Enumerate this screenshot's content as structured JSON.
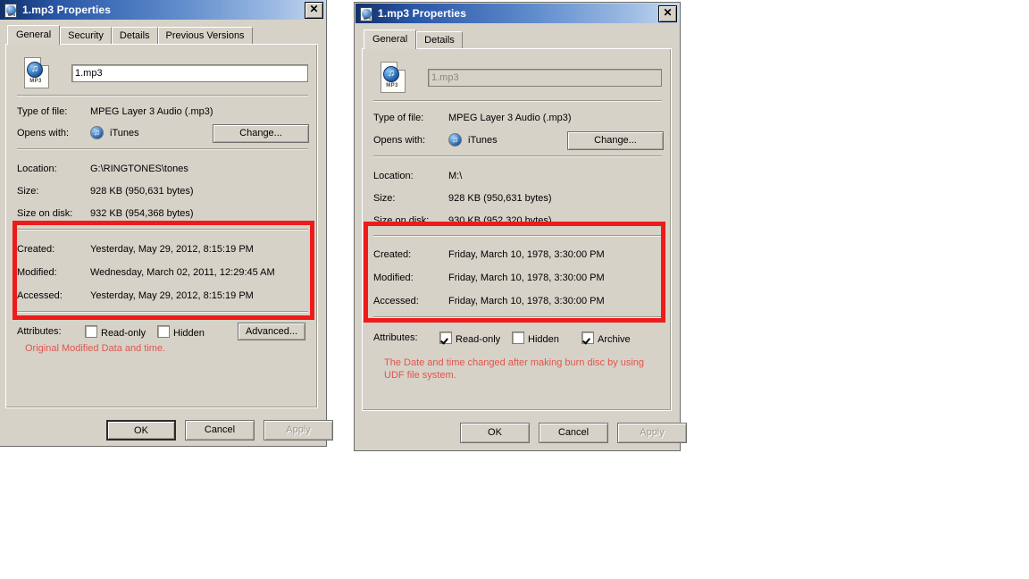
{
  "colors": {
    "dialog_face": "#d6d2c8",
    "titlebar_start": "#10316b",
    "titlebar_end": "#c6d9ef",
    "annotation_red": "#ee1b1b",
    "note_red": "#e0564e"
  },
  "windows": [
    {
      "id": "window-1",
      "title": "1.mp3 Properties",
      "title_icon": "mp3-file-icon",
      "close_label": "✕",
      "tabs": [
        {
          "label": "General",
          "active": true
        },
        {
          "label": "Security",
          "active": false
        },
        {
          "label": "Details",
          "active": false
        },
        {
          "label": "Previous Versions",
          "active": false
        }
      ],
      "file_icon": "mp3-file-icon",
      "filename": {
        "value": "1.mp3",
        "placeholder": "File name",
        "readonly": false
      },
      "fields": [
        {
          "key": "Type of file:",
          "value": "MPEG Layer 3 Audio (.mp3)"
        },
        {
          "key": "Opens with:",
          "value": "iTunes",
          "icon": "itunes-icon"
        },
        {
          "key": "Location:",
          "value": "G:\\RINGTONES\\tones"
        },
        {
          "key": "Size:",
          "value": "928 KB (950,631 bytes)"
        },
        {
          "key": "Size on disk:",
          "value": "932 KB (954,368 bytes)"
        },
        {
          "key": "Created:",
          "value": "Yesterday, May 29, 2012, 8:15:19 PM"
        },
        {
          "key": "Modified:",
          "value": "Wednesday, March 02, 2011, 12:29:45 AM"
        },
        {
          "key": "Accessed:",
          "value": "Yesterday, May 29, 2012, 8:15:19 PM"
        }
      ],
      "change_button": "Change...",
      "attributes_label": "Attributes:",
      "attributes": [
        {
          "label": "Read-only",
          "checked": false
        },
        {
          "label": "Hidden",
          "checked": false
        }
      ],
      "advanced_button": "Advanced...",
      "note": "Original Modified Data and time.",
      "footer": [
        {
          "label": "OK",
          "default": true,
          "disabled": false
        },
        {
          "label": "Cancel",
          "default": false,
          "disabled": false
        },
        {
          "label": "Apply",
          "default": false,
          "disabled": true
        }
      ]
    },
    {
      "id": "window-2",
      "title": "1.mp3 Properties",
      "title_icon": "mp3-file-icon",
      "close_label": "✕",
      "tabs": [
        {
          "label": "General",
          "active": true
        },
        {
          "label": "Details",
          "active": false
        }
      ],
      "file_icon": "mp3-file-icon",
      "filename": {
        "value": "1.mp3",
        "placeholder": "File name",
        "readonly": true
      },
      "fields": [
        {
          "key": "Type of file:",
          "value": "MPEG Layer 3 Audio (.mp3)"
        },
        {
          "key": "Opens with:",
          "value": "iTunes",
          "icon": "itunes-icon"
        },
        {
          "key": "Location:",
          "value": "M:\\"
        },
        {
          "key": "Size:",
          "value": "928 KB (950,631 bytes)"
        },
        {
          "key": "Size on disk:",
          "value": "930 KB (952,320 bytes)"
        },
        {
          "key": "Created:",
          "value": "Friday, March 10, 1978, 3:30:00 PM"
        },
        {
          "key": "Modified:",
          "value": "Friday, March 10, 1978, 3:30:00 PM"
        },
        {
          "key": "Accessed:",
          "value": "Friday, March 10, 1978, 3:30:00 PM"
        }
      ],
      "change_button": "Change...",
      "attributes_label": "Attributes:",
      "attributes": [
        {
          "label": "Read-only",
          "checked": true
        },
        {
          "label": "Hidden",
          "checked": false
        },
        {
          "label": "Archive",
          "checked": true
        }
      ],
      "note": "The Date and time changed after making burn disc by using UDF file system.",
      "footer": [
        {
          "label": "OK",
          "default": false,
          "disabled": false
        },
        {
          "label": "Cancel",
          "default": false,
          "disabled": false
        },
        {
          "label": "Apply",
          "default": false,
          "disabled": true
        }
      ]
    }
  ]
}
